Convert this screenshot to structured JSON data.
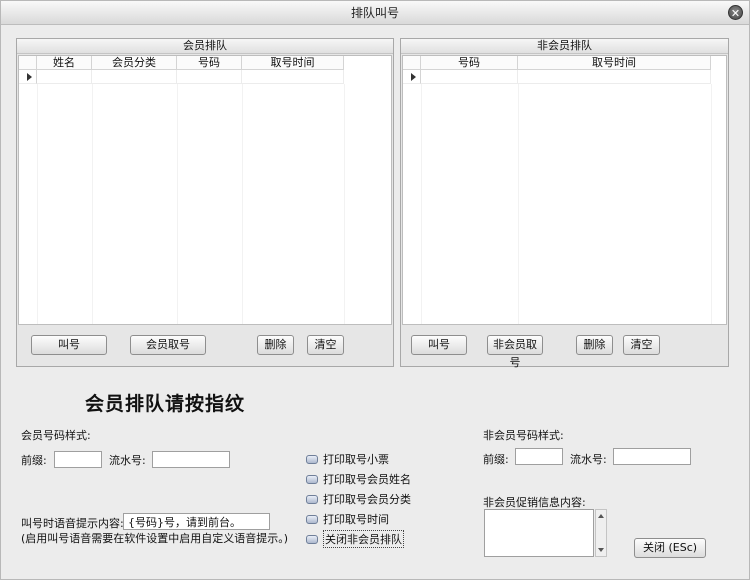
{
  "window": {
    "title": "排队叫号",
    "close_glyph": "✕"
  },
  "member_panel": {
    "title": "会员排队",
    "columns": [
      "姓名",
      "会员分类",
      "号码",
      "取号时间"
    ],
    "buttons": {
      "call": "叫号",
      "take_number": "会员取号",
      "delete": "删除",
      "clear": "清空"
    }
  },
  "nonmember_panel": {
    "title": "非会员排队",
    "columns": [
      "号码",
      "取号时间"
    ],
    "buttons": {
      "call": "叫号",
      "take_number": "非会员取号",
      "delete": "删除",
      "clear": "清空"
    }
  },
  "fingerprint_prompt": "会员排队请按指纹",
  "member_format": {
    "title": "会员号码样式:",
    "prefix_label": "前缀:",
    "prefix_value": "",
    "serial_label": "流水号:",
    "serial_value": ""
  },
  "voice": {
    "label": "叫号时语音提示内容:",
    "value": "{号码}号，请到前台。",
    "note": "(启用叫号语音需要在软件设置中启用自定义语音提示。)"
  },
  "options": [
    "打印取号小票",
    "打印取号会员姓名",
    "打印取号会员分类",
    "打印取号时间",
    "关闭非会员排队"
  ],
  "nonmember_format": {
    "title": "非会员号码样式:",
    "prefix_label": "前缀:",
    "prefix_value": "",
    "serial_label": "流水号:",
    "serial_value": ""
  },
  "promo": {
    "label": "非会员促销信息内容:",
    "value": ""
  },
  "close_button": "关闭 (ESc)"
}
